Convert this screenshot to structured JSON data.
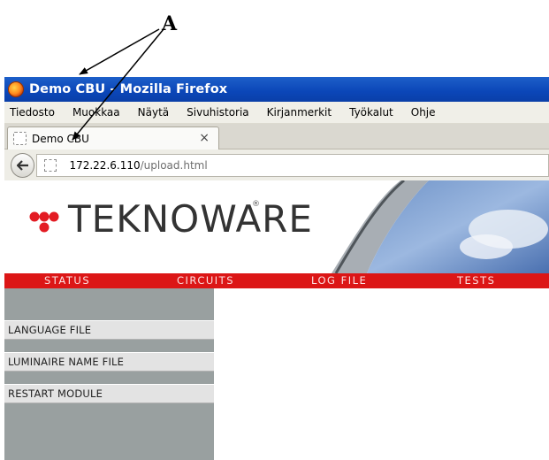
{
  "annotation": {
    "letter": "A"
  },
  "window": {
    "title": "Demo CBU - Mozilla Firefox",
    "menu": [
      "Tiedosto",
      "Muokkaa",
      "Näytä",
      "Sivuhistoria",
      "Kirjanmerkit",
      "Työkalut",
      "Ohje"
    ],
    "tab": {
      "label": "Demo CBU",
      "close": "×"
    },
    "url": {
      "host": "172.22.6.110",
      "path": "/upload.html"
    }
  },
  "page": {
    "logo": {
      "text": "TEKNOWARE",
      "registered": "®"
    },
    "nav": [
      "STATUS",
      "CIRCUITS",
      "LOG FILE",
      "TESTS"
    ],
    "sidebar": [
      "LANGUAGE FILE",
      "LUMINAIRE NAME FILE",
      "RESTART MODULE"
    ]
  },
  "colors": {
    "titlebar": "#0b46b8",
    "red_menu": "#dc1616",
    "sidebar": "#99a0a0"
  }
}
